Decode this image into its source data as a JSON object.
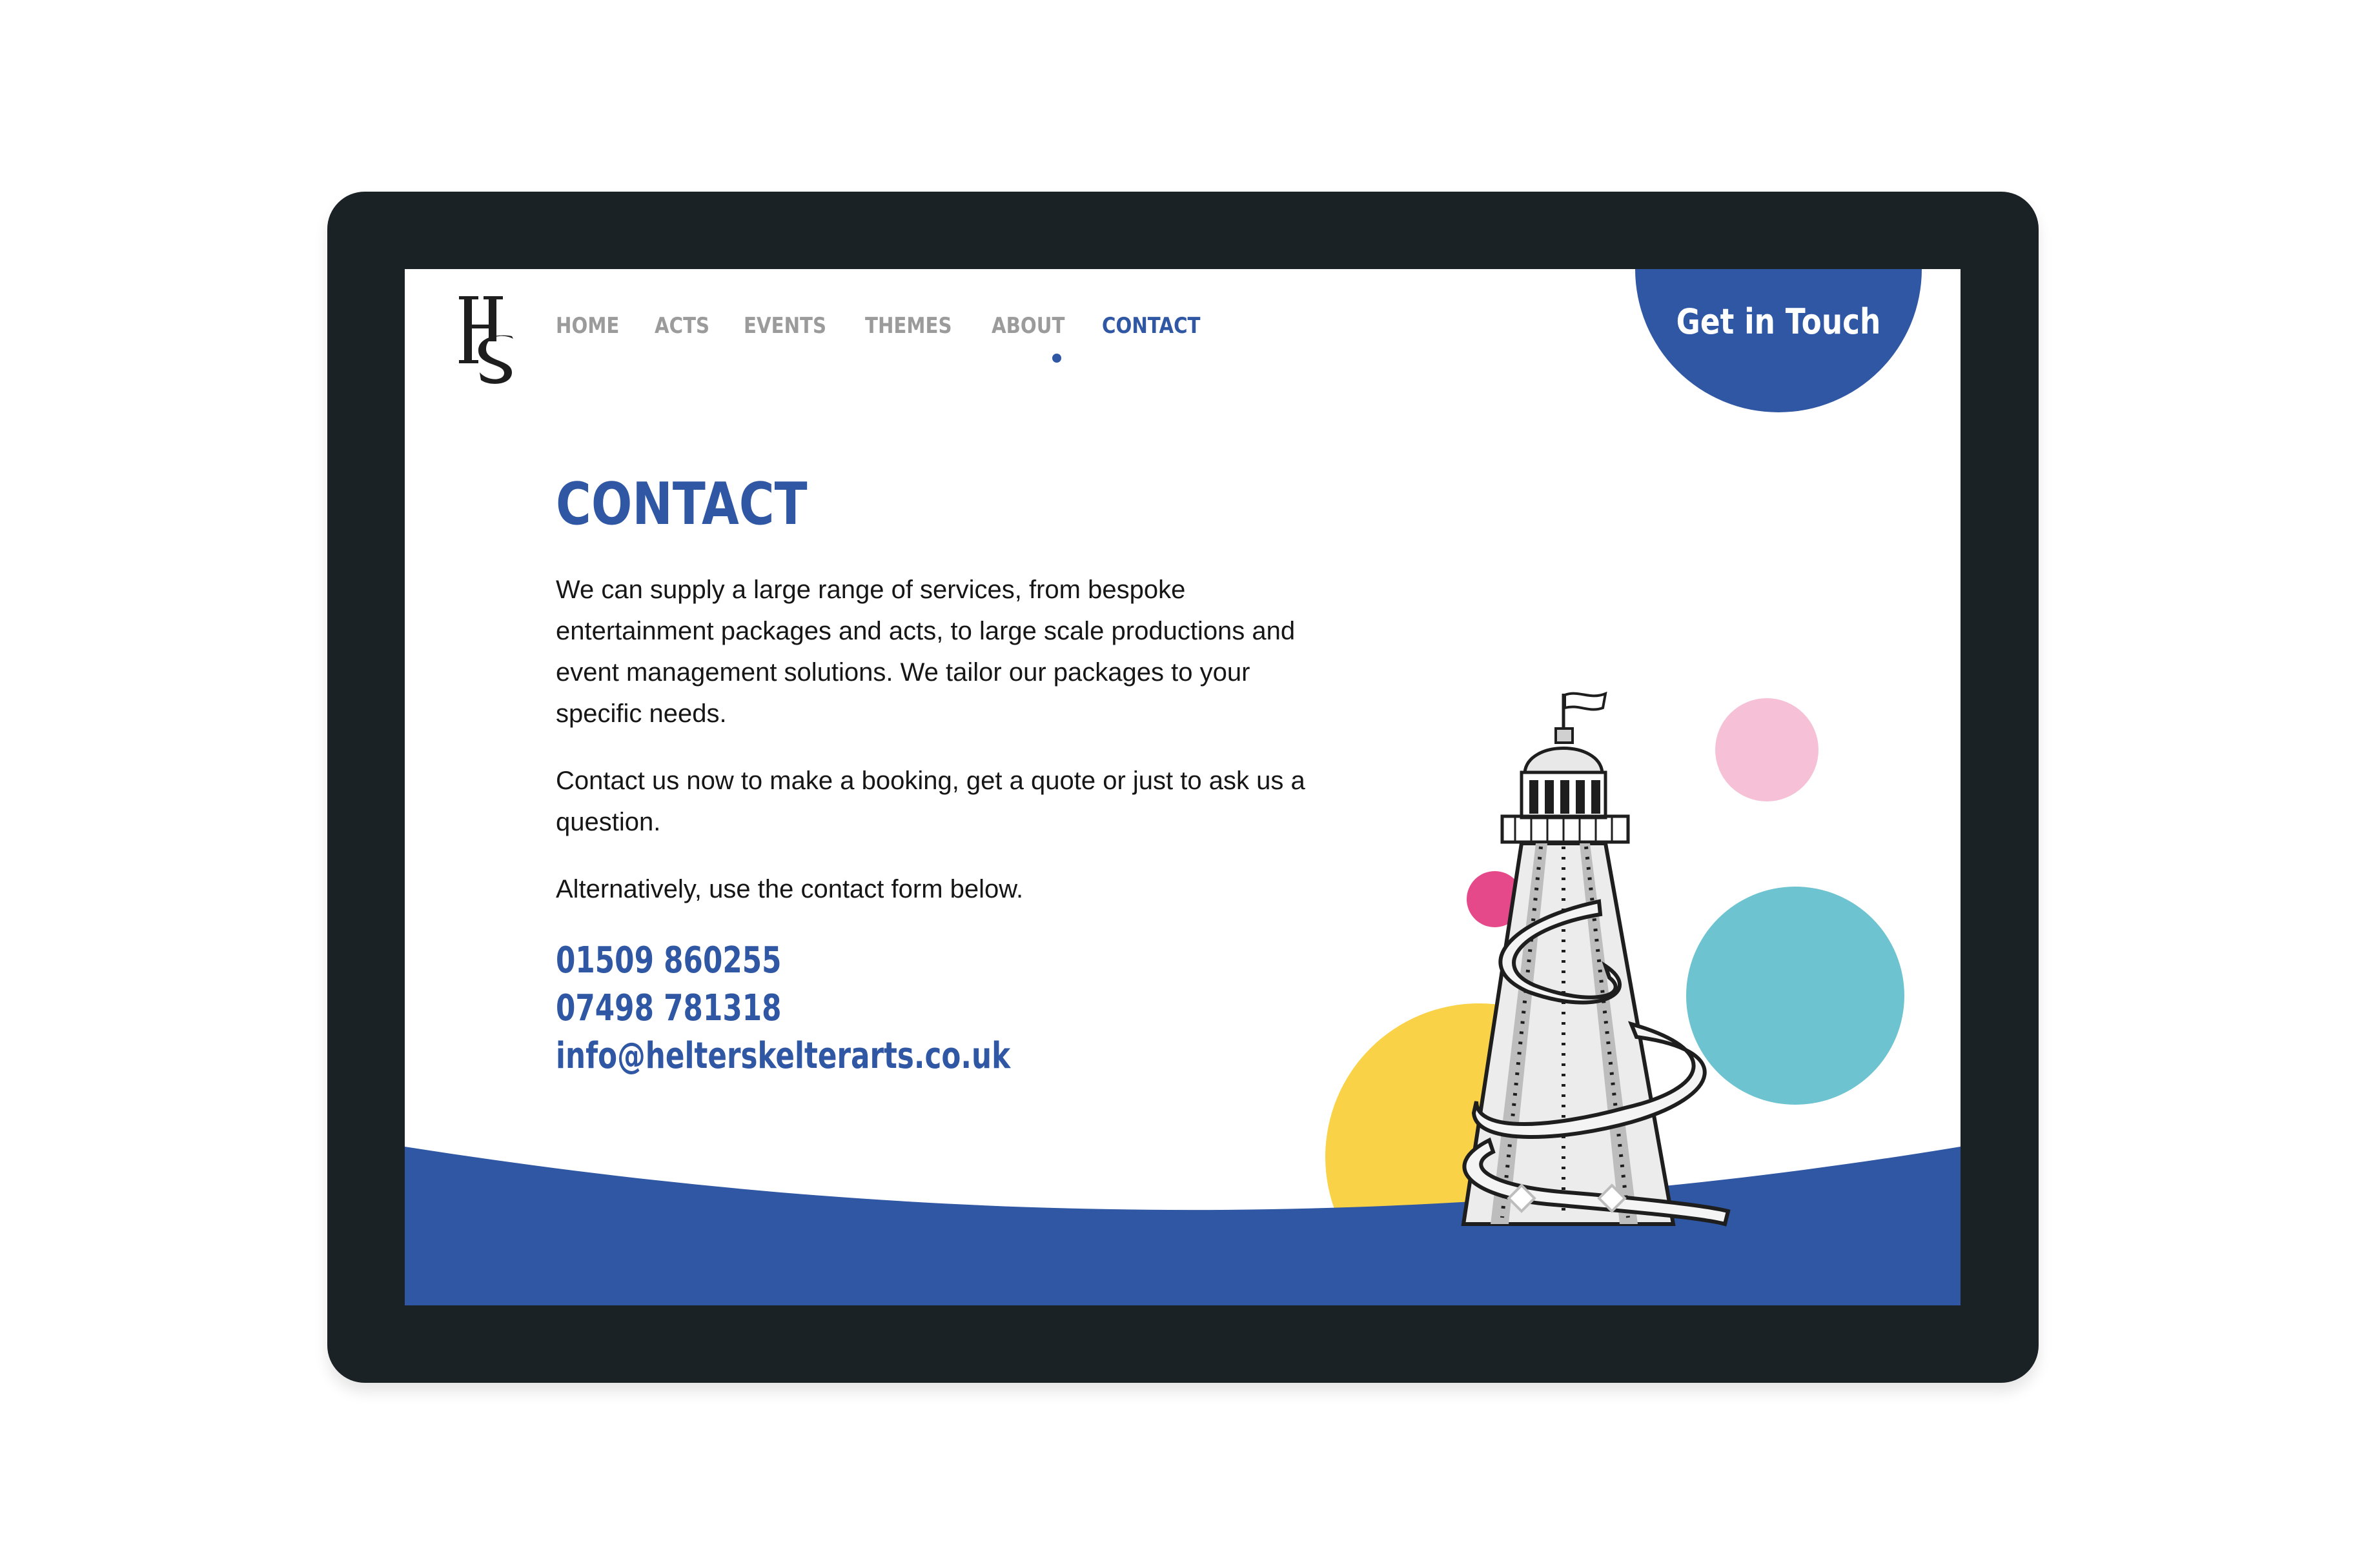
{
  "brand": {
    "logo_icon": "hs-monogram-logo",
    "colors": {
      "primary_blue": "#2f57a3",
      "nav_grey": "#9b9b9b",
      "device_frame": "#1b2225",
      "pink": "#f6c1d6",
      "magenta": "#e5498a",
      "cyan": "#6dc3cf",
      "yellow": "#f9d247"
    }
  },
  "nav": {
    "items": [
      {
        "label": "HOME"
      },
      {
        "label": "ACTS"
      },
      {
        "label": "EVENTS"
      },
      {
        "label": "THEMES"
      },
      {
        "label": "ABOUT"
      },
      {
        "label": "CONTACT"
      }
    ],
    "active": "CONTACT"
  },
  "cta": {
    "label": "Get in Touch"
  },
  "main": {
    "title": "CONTACT",
    "paragraphs": [
      "We can supply a large range of services, from bespoke entertainment packages and acts, to large scale productions and event management solutions. We tailor our packages to your specific needs.",
      "Contact us now to make a booking, get a quote or just to ask us a question.",
      "Alternatively, use the contact form below."
    ],
    "contacts": {
      "phone_1": "01509 860255",
      "phone_2": "07498 781318",
      "email": "info@helterskelterarts.co.uk"
    }
  },
  "illustration": {
    "icon": "helter-skelter-tower-illustration"
  }
}
